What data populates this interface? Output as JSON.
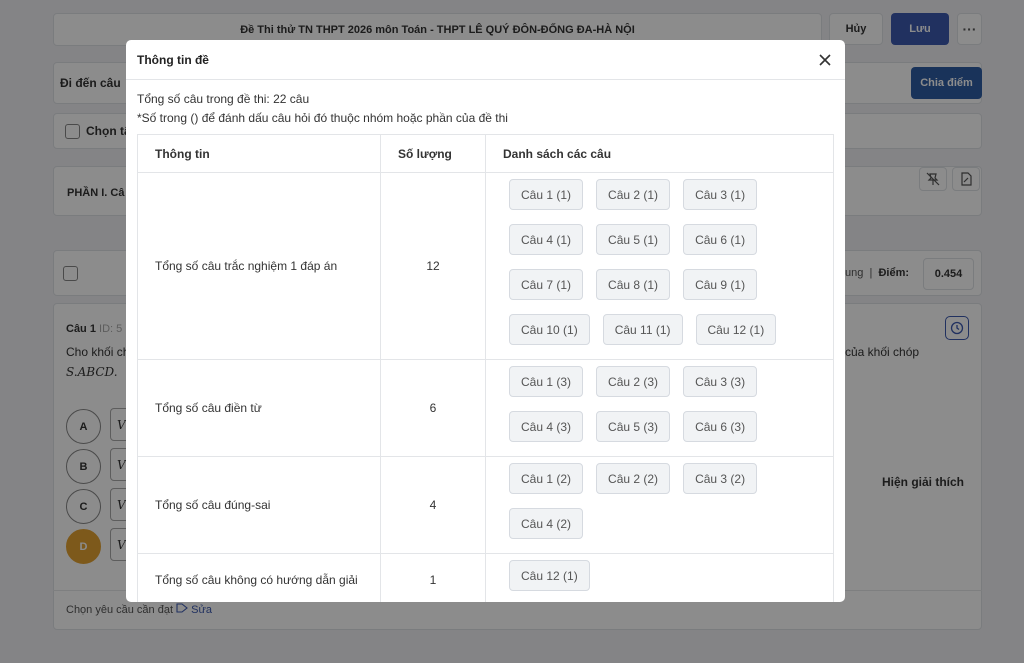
{
  "background": {
    "exam_title": "Đề Thi thử TN THPT 2026 môn Toán - THPT LÊ QUÝ ĐÔN-ĐỐNG ĐA-HÀ NỘI",
    "cancel_label": "Hủy",
    "save_label": "Lưu",
    "more_label": "···",
    "goto_label": "Đi đến câu",
    "split_score_label": "Chia điểm",
    "select_all_label": "Chọn tấ",
    "part_label": "PHẦN I. Câ",
    "score_prefix": "ung",
    "score_label": "Điểm:",
    "score_value": "0.454",
    "question_title": "Câu 1",
    "question_id": "ID: 5",
    "question_text": "Cho khối ch",
    "question_text_right": "của khối chóp",
    "question_math": "S.ABCD.",
    "options": [
      "A",
      "B",
      "C",
      "D"
    ],
    "option_value": "V",
    "show_explanation": "Hiện giải thích",
    "footer_req": "Chọn yêu cầu cần đạt",
    "footer_edit": "Sửa"
  },
  "modal": {
    "title": "Thông tin đề",
    "total_questions": "Tổng số câu trong đề thi: 22 câu",
    "note": "*Số trong () để đánh dấu câu hỏi đó thuộc nhóm hoặc phần của đề thi",
    "table": {
      "headers": [
        "Thông tin",
        "Số lượng",
        "Danh sách các câu"
      ],
      "rows": [
        {
          "info": "Tổng số câu trắc nghiệm 1 đáp án",
          "count": "12",
          "items": [
            "Câu 1  (1)",
            "Câu 2  (1)",
            "Câu 3  (1)",
            "Câu 4  (1)",
            "Câu 5  (1)",
            "Câu 6  (1)",
            "Câu 7  (1)",
            "Câu 8  (1)",
            "Câu 9  (1)",
            "Câu 10  (1)",
            "Câu 11  (1)",
            "Câu 12  (1)"
          ]
        },
        {
          "info": "Tổng số câu điền từ",
          "count": "6",
          "items": [
            "Câu 1  (3)",
            "Câu 2  (3)",
            "Câu 3  (3)",
            "Câu 4  (3)",
            "Câu 5  (3)",
            "Câu 6  (3)"
          ]
        },
        {
          "info": "Tổng số câu đúng-sai",
          "count": "4",
          "items": [
            "Câu 1  (2)",
            "Câu 2  (2)",
            "Câu 3  (2)",
            "Câu 4  (2)"
          ]
        },
        {
          "info": "Tổng số câu không có hướng dẫn giải",
          "count": "1",
          "items": [
            "Câu 12  (1)"
          ]
        }
      ]
    }
  }
}
